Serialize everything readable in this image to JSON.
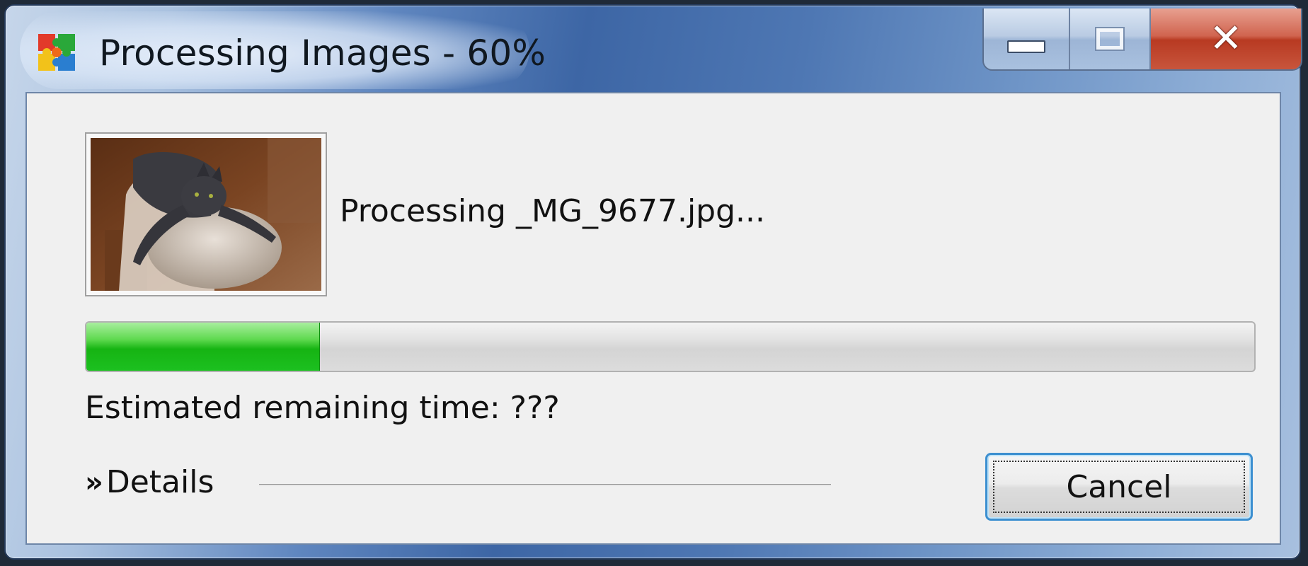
{
  "window": {
    "title": "Processing Images - 60%",
    "app_icon": "puzzle-app-icon"
  },
  "caption_buttons": {
    "minimize_icon": "minimize-icon",
    "maximize_icon": "maximize-icon",
    "close_icon": "close-icon",
    "close_glyph": "✕"
  },
  "body": {
    "thumbnail": "cat-photo-thumbnail",
    "processing_text": "Processing _MG_9677.jpg...",
    "progress": 0.2,
    "eta_text": "Estimated remaining time: ???",
    "details_chevron": "»",
    "details_label": "Details",
    "cancel_label": "Cancel"
  },
  "colors": {
    "progress_green": "#16b413",
    "focus_blue": "#3c8fd0",
    "close_red": "#c8553c"
  }
}
